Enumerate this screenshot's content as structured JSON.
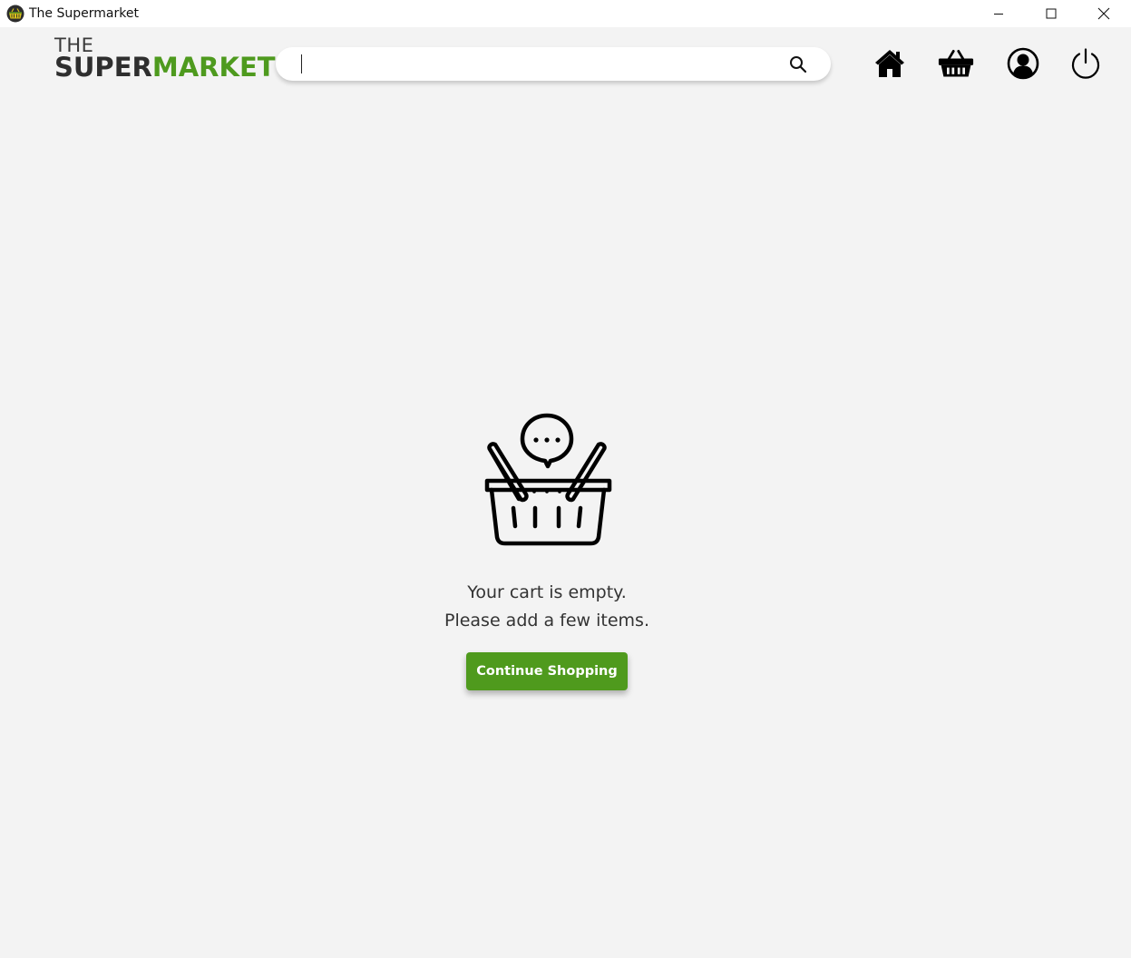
{
  "window": {
    "title": "The Supermarket"
  },
  "header": {
    "logo_top": "THE",
    "logo_main_dark": "SUPER",
    "logo_main_accent": "MARKET",
    "search": {
      "value": "",
      "placeholder": ""
    },
    "nav": [
      {
        "icon": "home-icon"
      },
      {
        "icon": "basket-icon"
      },
      {
        "icon": "profile-icon"
      },
      {
        "icon": "power-icon"
      }
    ]
  },
  "cart": {
    "empty_line1": "Your cart is empty.",
    "empty_line2": "Please add a few items.",
    "continue_label": "Continue Shopping"
  },
  "colors": {
    "brand_green": "#4f9a1d",
    "background": "#f3f3f3"
  }
}
